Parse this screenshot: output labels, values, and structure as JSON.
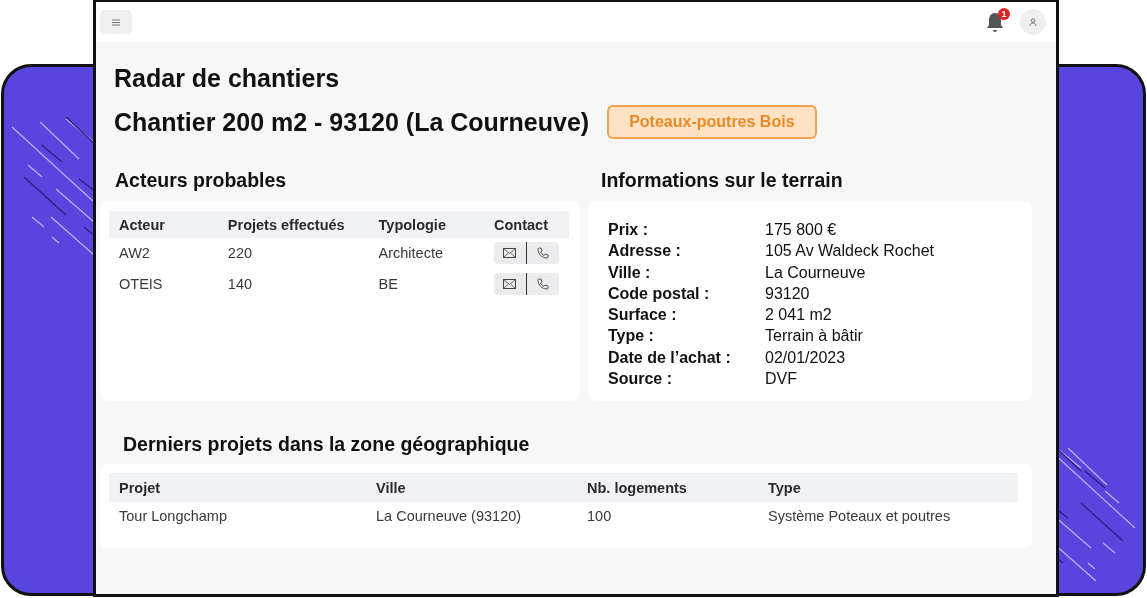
{
  "topbar": {
    "notification_count": "1"
  },
  "title": "Radar de chantiers",
  "project": {
    "name": "Chantier 200 m2 - 93120 (La Courneuve)",
    "tag": "Poteaux-poutres Bois"
  },
  "actors": {
    "heading": "Acteurs probables",
    "columns": [
      "Acteur",
      "Projets effectués",
      "Typologie",
      "Contact"
    ],
    "rows": [
      {
        "actor": "AW2",
        "projects": "220",
        "typology": "Architecte"
      },
      {
        "actor": "OTEIS",
        "projects": "140",
        "typology": "BE"
      }
    ]
  },
  "land": {
    "heading": "Informations sur le terrain",
    "fields": [
      {
        "label": "Prix :",
        "value": "175 800 €"
      },
      {
        "label": "Adresse :",
        "value": "105 Av Waldeck Rochet"
      },
      {
        "label": "Ville :",
        "value": "La Courneuve"
      },
      {
        "label": "Code postal :",
        "value": "93120"
      },
      {
        "label": "Surface :",
        "value": "2 041 m2"
      },
      {
        "label": "Type :",
        "value": "Terrain à bâtir"
      },
      {
        "label": "Date de l’achat :",
        "value": "02/01/2023"
      },
      {
        "label": "Source :",
        "value": "DVF"
      }
    ]
  },
  "recent": {
    "heading": "Derniers projets dans la zone géographique",
    "columns": [
      "Projet",
      "Ville",
      "Nb. logements",
      "Type"
    ],
    "rows": [
      [
        "Tour Longchamp",
        "La Courneuve (93120)",
        "100",
        "Système Poteaux et poutres"
      ]
    ]
  }
}
